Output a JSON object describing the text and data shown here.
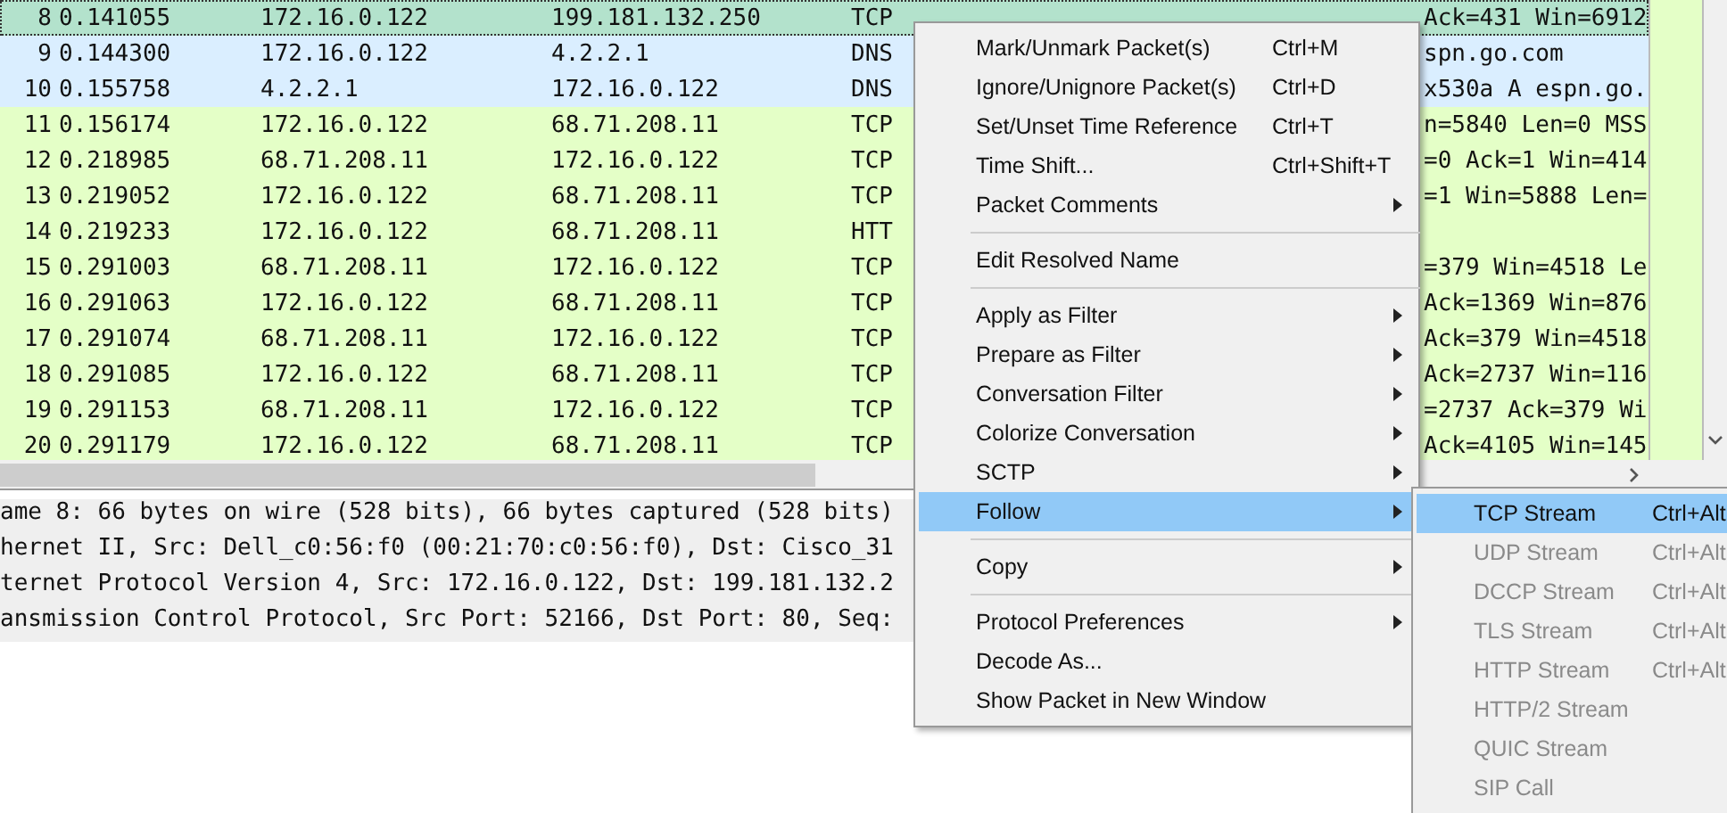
{
  "packets": [
    {
      "no": "8",
      "time": "0.141055",
      "source": "172.16.0.122",
      "destination": "199.181.132.250",
      "protocol": "TCP",
      "info": "Ack=431 Win=6912",
      "color": "#b3e2cc",
      "selected": true
    },
    {
      "no": "9",
      "time": "0.144300",
      "source": "172.16.0.122",
      "destination": "4.2.2.1",
      "protocol": "DNS",
      "info": "spn.go.com",
      "color": "#daeeff",
      "selected": false
    },
    {
      "no": "10",
      "time": "0.155758",
      "source": "4.2.2.1",
      "destination": "172.16.0.122",
      "protocol": "DNS",
      "info": "x530a A espn.go.",
      "color": "#daeeff",
      "selected": false
    },
    {
      "no": "11",
      "time": "0.156174",
      "source": "172.16.0.122",
      "destination": "68.71.208.11",
      "protocol": "TCP",
      "info": "n=5840 Len=0 MSS",
      "color": "#e4ffc7",
      "selected": false
    },
    {
      "no": "12",
      "time": "0.218985",
      "source": "68.71.208.11",
      "destination": "172.16.0.122",
      "protocol": "TCP",
      "info": "=0 Ack=1 Win=414",
      "color": "#e4ffc7",
      "selected": false
    },
    {
      "no": "13",
      "time": "0.219052",
      "source": "172.16.0.122",
      "destination": "68.71.208.11",
      "protocol": "TCP",
      "info": "=1 Win=5888 Len=",
      "color": "#e4ffc7",
      "selected": false
    },
    {
      "no": "14",
      "time": "0.219233",
      "source": "172.16.0.122",
      "destination": "68.71.208.11",
      "protocol": "HTT",
      "color": "#e4ffc7",
      "selected": false
    },
    {
      "no": "15",
      "time": "0.291003",
      "source": "68.71.208.11",
      "destination": "172.16.0.122",
      "protocol": "TCP",
      "info": "=379 Win=4518 Le",
      "color": "#e4ffc7",
      "selected": false
    },
    {
      "no": "16",
      "time": "0.291063",
      "source": "172.16.0.122",
      "destination": "68.71.208.11",
      "protocol": "TCP",
      "info": "Ack=1369 Win=876",
      "color": "#e4ffc7",
      "selected": false
    },
    {
      "no": "17",
      "time": "0.291074",
      "source": "68.71.208.11",
      "destination": "172.16.0.122",
      "protocol": "TCP",
      "info": "Ack=379 Win=4518",
      "color": "#e4ffc7",
      "selected": false
    },
    {
      "no": "18",
      "time": "0.291085",
      "source": "172.16.0.122",
      "destination": "68.71.208.11",
      "protocol": "TCP",
      "info": "Ack=2737 Win=116",
      "color": "#e4ffc7",
      "selected": false
    },
    {
      "no": "19",
      "time": "0.291153",
      "source": "68.71.208.11",
      "destination": "172.16.0.122",
      "protocol": "TCP",
      "info": "=2737 Ack=379 Wi",
      "color": "#e4ffc7",
      "selected": false
    },
    {
      "no": "20",
      "time": "0.291179",
      "source": "172.16.0.122",
      "destination": "68.71.208.11",
      "protocol": "TCP",
      "info": "Ack=4105 Win=145",
      "color": "#e4ffc7",
      "selected": false
    }
  ],
  "details": [
    "ame 8: 66 bytes on wire (528 bits), 66 bytes captured (528 bits)",
    "hernet II, Src: Dell_c0:56:f0 (00:21:70:c0:56:f0), Dst: Cisco_31",
    "ternet Protocol Version 4, Src: 172.16.0.122, Dst: 199.181.132.2",
    "ansmission Control Protocol, Src Port: 52166, Dst Port: 80, Seq:"
  ],
  "context_menu": [
    {
      "kind": "item",
      "label": "Mark/Unmark Packet(s)",
      "shortcut": "Ctrl+M",
      "submenu": false,
      "selected": false
    },
    {
      "kind": "item",
      "label": "Ignore/Unignore Packet(s)",
      "shortcut": "Ctrl+D",
      "submenu": false,
      "selected": false
    },
    {
      "kind": "item",
      "label": "Set/Unset Time Reference",
      "shortcut": "Ctrl+T",
      "submenu": false,
      "selected": false
    },
    {
      "kind": "item",
      "label": "Time Shift...",
      "shortcut": "Ctrl+Shift+T",
      "submenu": false,
      "selected": false
    },
    {
      "kind": "item",
      "label": "Packet Comments",
      "submenu": true,
      "selected": false
    },
    {
      "kind": "separator"
    },
    {
      "kind": "item",
      "label": "Edit Resolved Name",
      "submenu": false,
      "selected": false
    },
    {
      "kind": "separator"
    },
    {
      "kind": "item",
      "label": "Apply as Filter",
      "submenu": true,
      "selected": false
    },
    {
      "kind": "item",
      "label": "Prepare as Filter",
      "submenu": true,
      "selected": false
    },
    {
      "kind": "item",
      "label": "Conversation Filter",
      "submenu": true,
      "selected": false
    },
    {
      "kind": "item",
      "label": "Colorize Conversation",
      "submenu": true,
      "selected": false
    },
    {
      "kind": "item",
      "label": "SCTP",
      "submenu": true,
      "selected": false
    },
    {
      "kind": "item",
      "label": "Follow",
      "submenu": true,
      "selected": true
    },
    {
      "kind": "separator"
    },
    {
      "kind": "item",
      "label": "Copy",
      "submenu": true,
      "selected": false
    },
    {
      "kind": "separator"
    },
    {
      "kind": "item",
      "label": "Protocol Preferences",
      "submenu": true,
      "selected": false
    },
    {
      "kind": "item",
      "label": "Decode As...",
      "submenu": false,
      "selected": false
    },
    {
      "kind": "item",
      "label": "Show Packet in New Window",
      "submenu": false,
      "selected": false
    }
  ],
  "follow_submenu": [
    {
      "label": "TCP Stream",
      "shortcut": "Ctrl+Alt",
      "disabled": false,
      "selected": true
    },
    {
      "label": "UDP Stream",
      "shortcut": "Ctrl+Alt",
      "disabled": true,
      "selected": false
    },
    {
      "label": "DCCP Stream",
      "shortcut": "Ctrl+Alt",
      "disabled": true,
      "selected": false
    },
    {
      "label": "TLS Stream",
      "shortcut": "Ctrl+Alt",
      "disabled": true,
      "selected": false
    },
    {
      "label": "HTTP Stream",
      "shortcut": "Ctrl+Alt",
      "disabled": true,
      "selected": false
    },
    {
      "label": "HTTP/2 Stream",
      "disabled": true,
      "selected": false
    },
    {
      "label": "QUIC Stream",
      "disabled": true,
      "selected": false
    },
    {
      "label": "SIP Call",
      "disabled": true,
      "selected": false
    }
  ]
}
